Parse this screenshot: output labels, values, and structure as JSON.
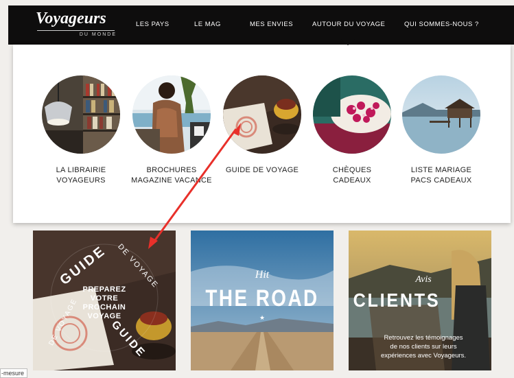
{
  "logo": {
    "main": "Voyageurs",
    "sub": "DU MONDE"
  },
  "nav": [
    {
      "label": "LES PAYS"
    },
    {
      "label": "LE MAG"
    },
    {
      "label": "MES ENVIES"
    },
    {
      "label": "AUTOUR DU VOYAGE"
    },
    {
      "label": "QUI SOMMES-NOUS ?"
    }
  ],
  "menu": {
    "items": [
      {
        "line1": "LA LIBRAIRIE",
        "line2": "VOYAGEURS"
      },
      {
        "line1": "BROCHURES",
        "line2": "MAGAZINE VACANCE"
      },
      {
        "line1": "GUIDE DE VOYAGE",
        "line2": ""
      },
      {
        "line1": "CHÈQUES",
        "line2": "CADEAUX"
      },
      {
        "line1": "LISTE MARIAGE",
        "line2": "PACS CADEAUX"
      }
    ]
  },
  "cards": {
    "guide": {
      "arc_top": "GUIDE",
      "arc_right": "DE VOYAGE",
      "l1": "PREPAREZ",
      "l2": "VOTRE",
      "l3": "PROCHAIN",
      "l4": "VOYAGE",
      "arc_bl": "DE VOYAGE",
      "arc_br": "GUIDE"
    },
    "road": {
      "script": "Hit",
      "title": "THE ROAD",
      "star": "★"
    },
    "clients": {
      "script": "Avis",
      "title": "CLIENTS",
      "l1": "Retrouvez les témoignages",
      "l2": "de nos clients sur leurs",
      "l3": "expériences avec Voyageurs."
    }
  },
  "status_bar": "-mesure",
  "colors": {
    "topbar": "#0e0d0d",
    "arrow": "#e8302a",
    "panel": "#ffffff"
  }
}
